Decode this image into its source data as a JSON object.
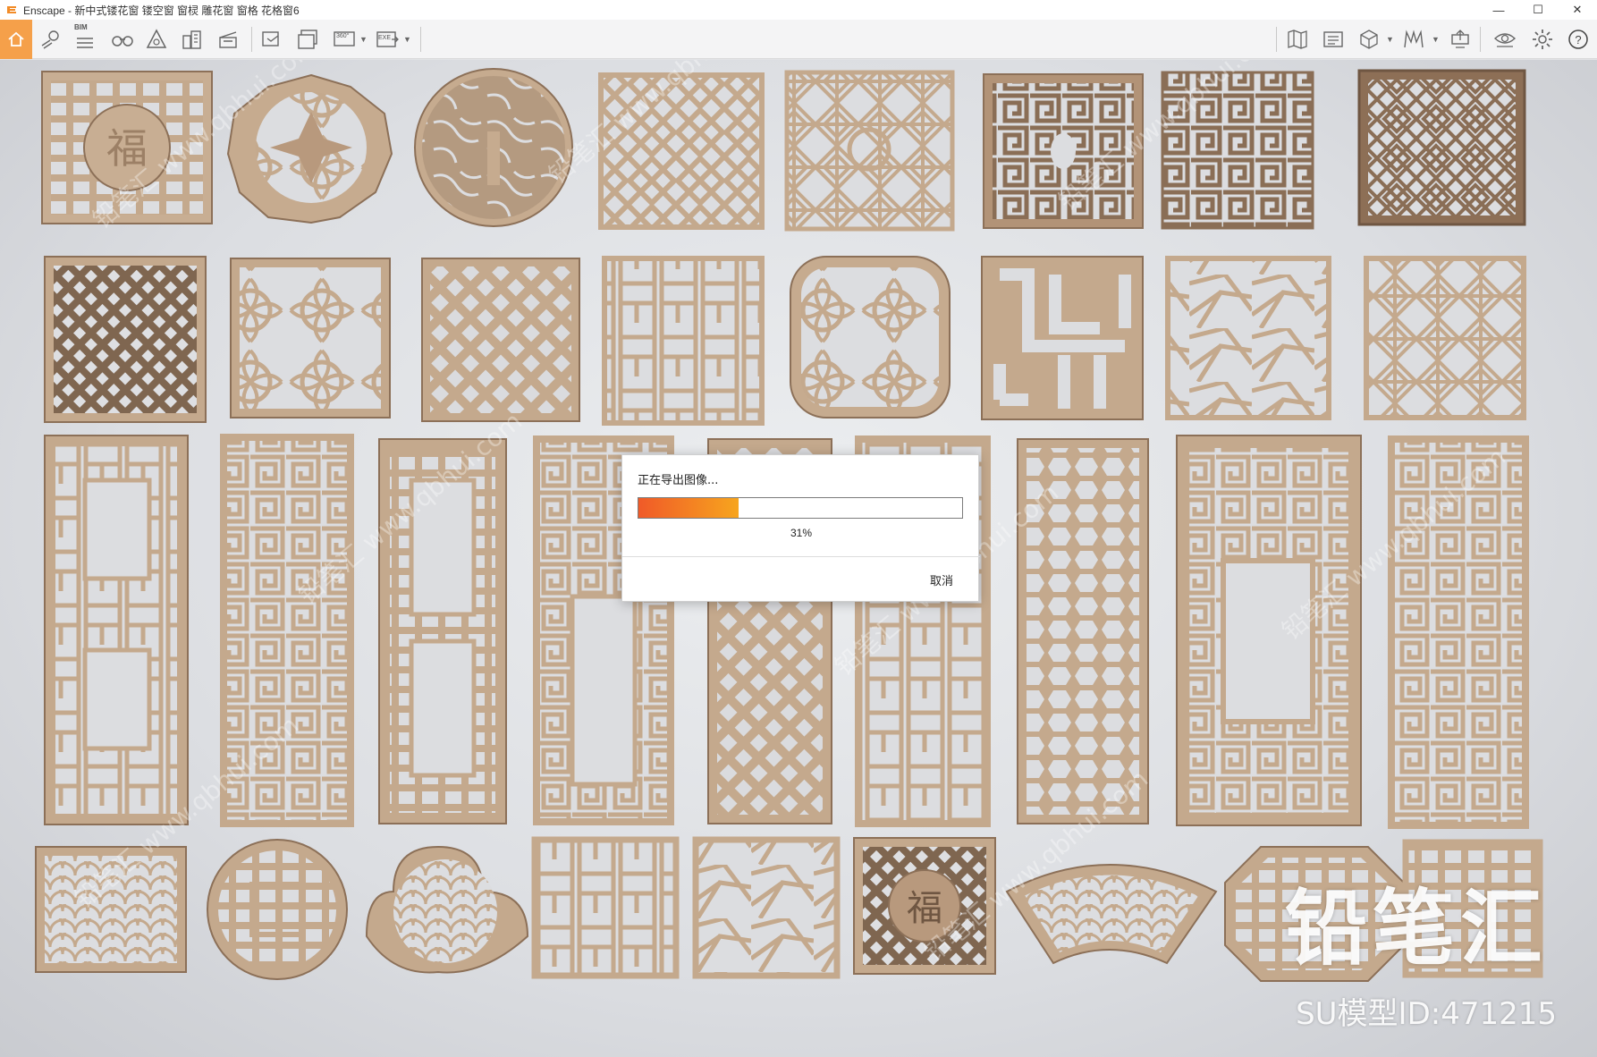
{
  "window": {
    "app_name": "Enscape",
    "title": "Enscape - 新中式镂花窗 镂空窗 窗棂 雕花窗 窗格 花格窗6",
    "controls": {
      "minimize": "—",
      "maximize": "☐",
      "close": "✕"
    }
  },
  "toolbar": {
    "bim_label": "BIM",
    "groups": [
      [
        "home-icon",
        "map-pin-icon",
        "bim-list-icon",
        "binoculars-icon",
        "perspective-icon",
        "buildings-icon",
        "asset-library-icon"
      ],
      [
        "screenshot-icon",
        "batch-render-icon",
        "panorama-360-icon",
        "export-exe-icon"
      ],
      [
        "map-icon",
        "visual-settings-icon",
        "cube-icon",
        "material-editor-icon",
        "upload-icon"
      ],
      [
        "view-icon",
        "settings-icon",
        "help-icon"
      ]
    ],
    "panorama_label": "360°",
    "exe_label": "EXE"
  },
  "colors": {
    "wood": "#c8ae93",
    "wood_dark": "#8c7058",
    "wood_light": "#dcc7ae",
    "accent_orange": "#f5a04a",
    "progress_start": "#f05a28",
    "progress_end": "#f7a51e"
  },
  "dialog": {
    "title": "正在导出图像...",
    "progress_percent": 31,
    "progress_label": "31%",
    "cancel_label": "取消"
  },
  "watermark": {
    "brand": "铅笔汇",
    "model_id": "SU模型ID:471215",
    "diagonal_text": "铅笔汇 www.qbhui.com"
  }
}
